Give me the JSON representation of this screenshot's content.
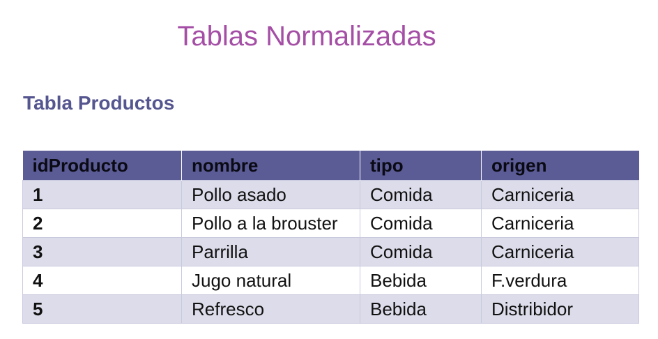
{
  "title": "Tablas Normalizadas",
  "subtitle": "Tabla Productos",
  "table": {
    "headers": [
      "idProducto",
      "nombre",
      "tipo",
      "origen"
    ],
    "rows": [
      [
        "1",
        "Pollo asado",
        "Comida",
        "Carniceria"
      ],
      [
        "2",
        "Pollo a la brouster",
        "Comida",
        "Carniceria"
      ],
      [
        "3",
        "Parrilla",
        "Comida",
        "Carniceria"
      ],
      [
        "4",
        "Jugo natural",
        "Bebida",
        "F.verdura"
      ],
      [
        "5",
        "Refresco",
        "Bebida",
        "Distribidor"
      ]
    ]
  },
  "colors": {
    "title": "#a54ea5",
    "subtitle": "#555590",
    "header_bg": "#5b5b96",
    "row_alt_bg": "#dcdcea"
  }
}
